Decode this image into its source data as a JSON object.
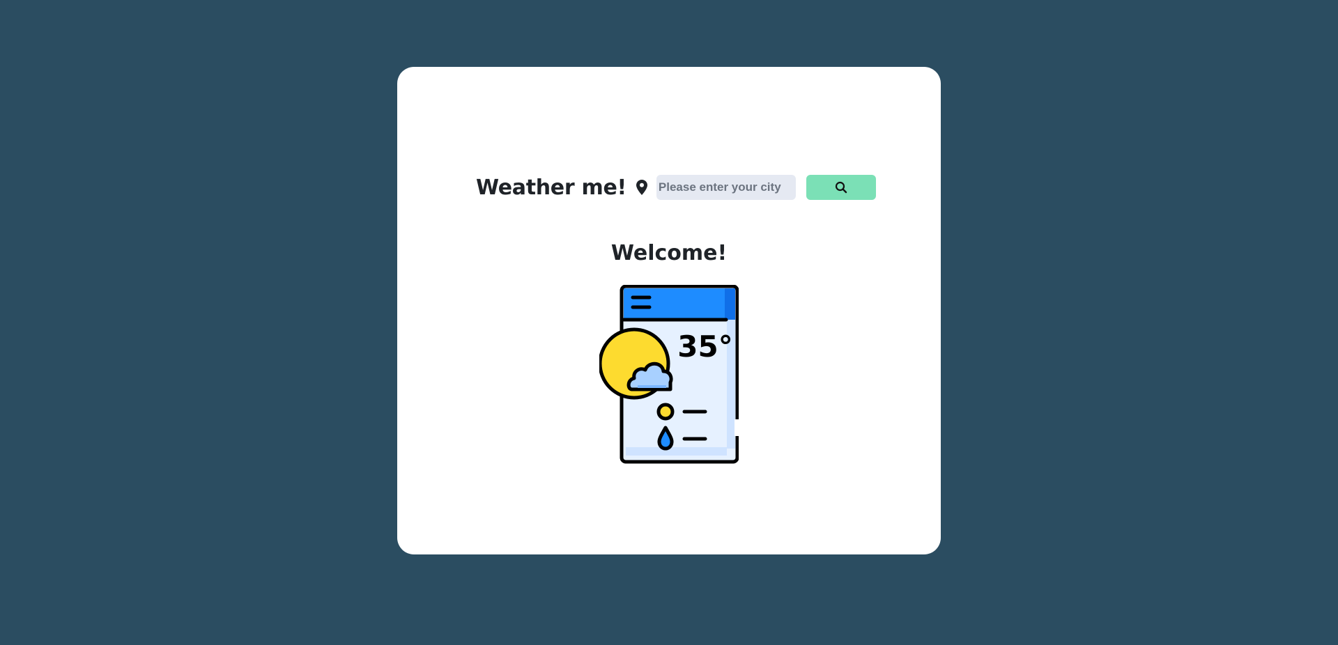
{
  "header": {
    "title": "Weather me!",
    "location_icon": "map-pin-icon"
  },
  "search": {
    "placeholder": "Please enter your city",
    "value": "",
    "button_icon": "search-icon"
  },
  "main": {
    "welcome_text": "Welcome!",
    "illustration": {
      "icon": "weather-app-phone-icon",
      "temperature_text": "35°"
    }
  },
  "colors": {
    "page_background": "#2b4d61",
    "card_background": "#ffffff",
    "input_background": "#e5e9f2",
    "button_background": "#7be0b6",
    "text": "#1f2328",
    "phone_header": "#1e8cff",
    "sun": "#fdd835"
  }
}
